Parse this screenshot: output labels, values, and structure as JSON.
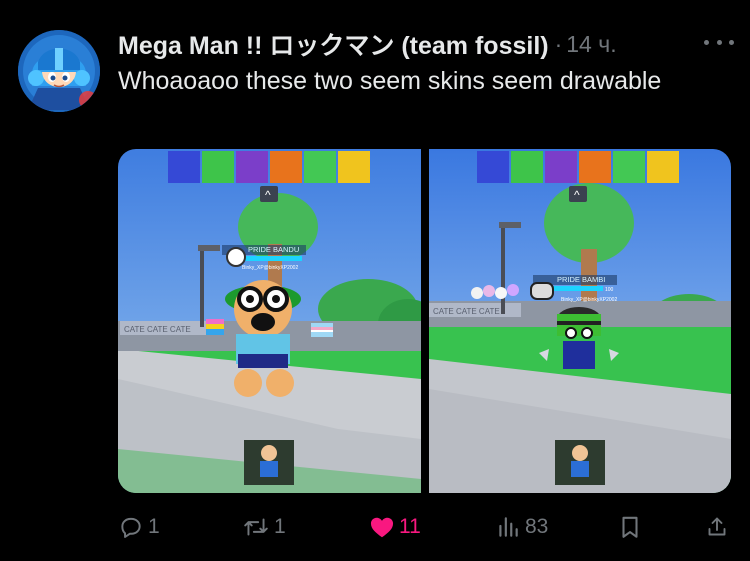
{
  "author": {
    "display_name": "Mega Man !! ロックマン (team fossil)",
    "separator": "·",
    "time": "14 ч."
  },
  "tweet": {
    "text": "Whoaoaoo these two seem skins seem drawable"
  },
  "media": {
    "left": {
      "nameplate": "PRIDE BANDU",
      "subtag": "Binky_XP@binkyXP2002",
      "sign": "CATE CATE CATE",
      "prompt": "^"
    },
    "right": {
      "nameplate": "PRIDE BAMBI",
      "level": "100",
      "subtag": "Binky_XP@binkyXP2002",
      "sign": "CATE CATE CATE",
      "prompt": "^"
    }
  },
  "actions": {
    "replies": "1",
    "reposts": "1",
    "likes": "11",
    "views": "83"
  },
  "colors": {
    "background": "#000000",
    "text": "#e7e9ea",
    "muted": "#71767b",
    "like_active": "#f91880"
  }
}
